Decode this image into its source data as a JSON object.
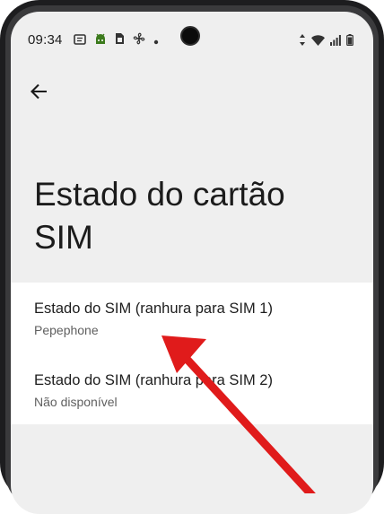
{
  "status_bar": {
    "time": "09:34",
    "left_icons": [
      "message-icon",
      "android-icon",
      "sim-icon",
      "fan-icon",
      "dot-icon"
    ],
    "right_icons": [
      "data-arrows-icon",
      "wifi-icon",
      "signal-icon",
      "battery-icon"
    ]
  },
  "header": {
    "back_icon": "arrow-left-icon"
  },
  "page": {
    "title_line1": "Estado do cartão",
    "title_line2": "SIM"
  },
  "list": {
    "items": [
      {
        "title": "Estado do SIM (ranhura para SIM 1)",
        "subtitle": "Pepephone"
      },
      {
        "title": "Estado do SIM (ranhura para SIM 2)",
        "subtitle": "Não disponível"
      }
    ]
  },
  "annotation": {
    "arrow_color": "#e01b1b"
  }
}
